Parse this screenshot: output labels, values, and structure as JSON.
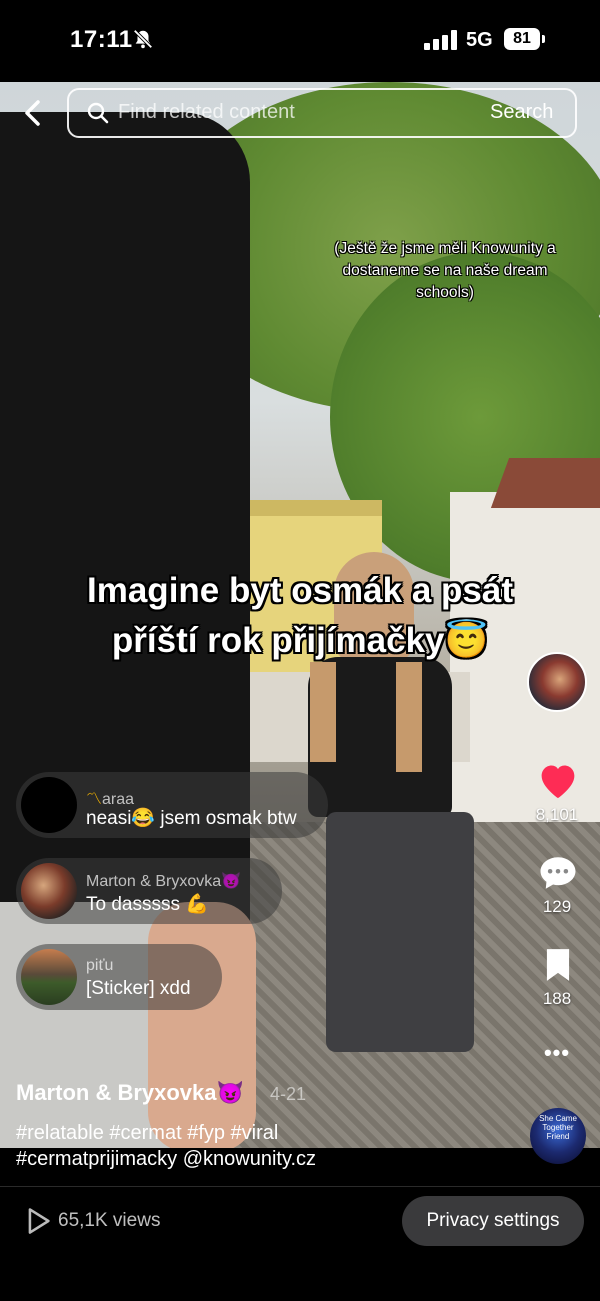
{
  "status_bar": {
    "time": "17:11",
    "network": "5G",
    "battery": "81"
  },
  "search": {
    "placeholder": "Find related content",
    "button_label": "Search"
  },
  "video": {
    "caption_small": "(Ještě že jsme měli Knowunity a dostaneme se na naše dream schools)",
    "caption_big_line1": "Imagine byt osmák a psát",
    "caption_big_line2": "příští rok přijímačky😇"
  },
  "comments": [
    {
      "user": "araa",
      "user_prefix": "〽",
      "text": "neasi😂 jsem osmak btw"
    },
    {
      "user": "Marton & Bryxovka😈",
      "text": "To dasssss 💪"
    },
    {
      "user": "piťu",
      "text": "[Sticker] xdd"
    }
  ],
  "rail": {
    "likes": "8,101",
    "comments": "129",
    "saves": "188",
    "more": "•••",
    "sound_label": "She Came Together Friend"
  },
  "post": {
    "author": "Marton & Bryxovka😈",
    "date": "4-21",
    "hashtags_line1": "#relatable #cermat #fyp #viral",
    "hashtags_line2": "#cermatprijimacky @knowunity.cz"
  },
  "bottom": {
    "views": "65,1K views",
    "privacy_label": "Privacy settings"
  },
  "colors": {
    "like_red": "#fe2c55",
    "bar_bg": "#000000",
    "pill_bg": "#3a3a3c"
  }
}
